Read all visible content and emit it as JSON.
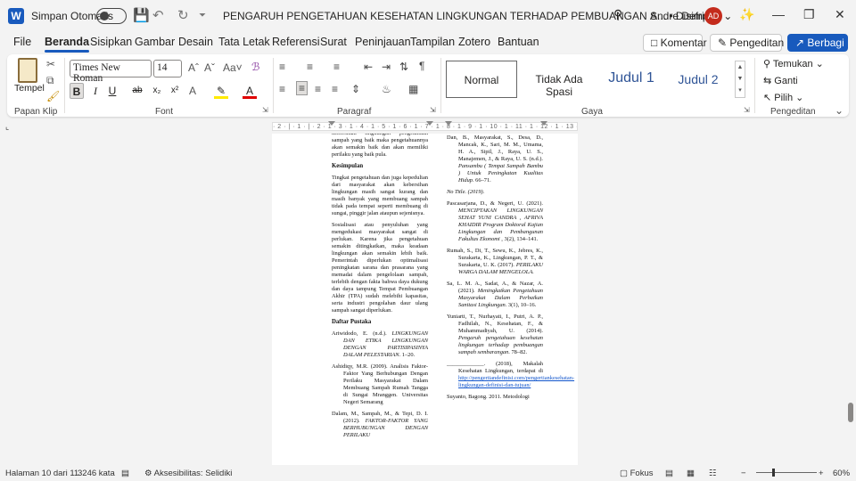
{
  "app": {
    "word_logo": "W",
    "autosave_label": "Simpan Otomatis",
    "doc_title": "PENGARUH PENGETAHUAN KESEHATAN LINGKUNGAN TERHADAP PEMBUANGAN S...",
    "save_state": "• Disimpan",
    "user_name": "Andre Defrian",
    "user_initials": "AD"
  },
  "menu": [
    "File",
    "Beranda",
    "Sisipkan",
    "Gambar",
    "Desain",
    "Tata Letak",
    "Referensi",
    "Surat",
    "Peninjauan",
    "Tampilan",
    "Zotero",
    "Bantuan"
  ],
  "actions": {
    "comment": "Komentar",
    "editing": "Pengeditan",
    "share": "Berbagi"
  },
  "ribbon": {
    "clipboard": {
      "label": "Papan Klip",
      "paste": "Tempel"
    },
    "font": {
      "label": "Font",
      "font_name": "Times New Roman",
      "font_size": "14"
    },
    "paragraph": {
      "label": "Paragraf"
    },
    "styles": {
      "label": "Gaya",
      "items": [
        "Normal",
        "Tidak Ada Spasi",
        "Judul 1",
        "Judul 2"
      ]
    },
    "editing": {
      "label": "Pengeditan",
      "find": "Temukan",
      "replace": "Ganti",
      "select": "Pilih"
    }
  },
  "ruler_text": "· 2 · | · 1 · | · 2 · 1 · 3 · 1 · 4 · 1 · 5 · 1 · 6 · 1 · 7 · 1 · 8 · 1 · 9 · 1 · 10 · 1 · 11 · 1 · 12 · 1 · 13 · 1",
  "document": {
    "col1_intro": "kebersihan lingkungan pengetahuan sampah yang baik maka pengetahuannya akan semakin baik dan akan memiliki perilaku yang baik pula.",
    "kesimpulan_heading": "Kesimpulan",
    "kesimpulan_p1": "Tingkat pengetahuan dan juga kepedulian dari masyarakat akan kebersihan lingkungan masih sangat kurang dan masih banyak yang membuang sampah tidak pada tempat seperti membuang di sungai, pinggir jalan ataupun sejenisnya.",
    "kesimpulan_p2": "Sosialisasi atau penyuluhan yang mengedukasi masyarakat sangat di perlukan. Karena jika pengetahuan semakin ditingkatkan, maka keadaan lingkungan akan semakin lebih baik. Pemerintah diperlukan optimalisasi peningkatan sarana dan prasarana yang memadai dalam pengelolaan sampah, terlebih dengan fakta bahwa daya dukung dan daya tampung Tempat Pembuangan Akhir (TPA) sudah melebihi kapasitas, serta industri pengolahan daur ulang sampah sangat diperlukan.",
    "daftar_heading": "Daftar Pustaka",
    "ref1_plain": "Ariwidodo, E. (n.d.). ",
    "ref1_italic": "LINGKUNGAN DAN ETIKA LINGKUNGAN DENGAN PARTISIPASINYA DALAM PELESTARIAN",
    "ref1_tail": ". 1–20.",
    "ref2": "Ashidiqy, M.R. (2009). Analisis Faktor-Faktor Yang Berhubungan Dengan Perilaku Masyarakat Dalam Membuang Sampah Rumah Tangga di Sungai Mranggen. Universitas Negeri Semarang",
    "ref3_plain": "Dalam, M., Sampah, M., & Tepi, D. I. (2012). ",
    "ref3_italic": "FAKTOR-FAKTOR YANG BERHUBUNGAN DENGAN PERILAKU",
    "ref4_plain": "Dan, B., Masyarakat, S., Desa, D., Mancak, K., Sari, M. M., Umama, H. A., Sipil, J., Raya, U. S., Manajemen, J., & Raya, U. S. (n.d.). ",
    "ref4_italic": "Pansambu ( Tempat Sampah Bambu ) Untuk Peningkatan Kualitas Hidup",
    "ref4_tail": ". 66–71.",
    "ref5": "No Title. (2019).",
    "ref6_plain": "Pascasarjana, D., & Negeri, U. (2021). ",
    "ref6_italic": "MENCIPTAKAN LINGKUNGAN SEHAT YUNI CANDRA , AFRIVA KHAIDIR Program Doktoral Kajian Lingkungan dan Pembangunan Fakultas Ekonomi",
    "ref6_tail": " , 3(2), 134–141.",
    "ref7_plain": "Rumah, S., Di, T., Sewu, K., Jebres, K., Surakarta, K., Lingkungan, P. T., & Surakarta, U. K. (2017). ",
    "ref7_italic": "PERILAKU WARGA DALAM MENGELOLA.",
    "ref8_plain": "Sa, L. M. A., Sadat, A., & Nazar, A. (2021). ",
    "ref8_italic": "Meningkatkan Pengetahuan Masyarakat Dalam Perbaikan Sanitasi Lingkungan",
    "ref8_tail": ". 3(1), 10–16.",
    "ref9_plain": "Yuniarti, T., Nurhayati, I., Putri, A. P., Fadhilah, N., Kesehatan, F., & Muhammadiyah, U. (2014). ",
    "ref9_italic": "Pengaruh pengetahuan kesehatan lingkungan terhadap pembuangan sampah sembarangan",
    "ref9_tail": ". 78–82.",
    "ref10_plain": "_____________. (2018), Makalah Kesehatan Lingkungan, terdapat di ",
    "ref10_link": "http://pengertiandefinisi.com/pengertiankesehatan-lingkungan-definisi-dan-tujuan/",
    "ref11": "Suyanto, Bagong. 2011. Metodologi"
  },
  "status": {
    "page": "Halaman 10 dari 11",
    "words": "3246 kata",
    "accessibility": "Aksesibilitas: Selidiki",
    "focus": "Fokus",
    "zoom": "60%"
  }
}
